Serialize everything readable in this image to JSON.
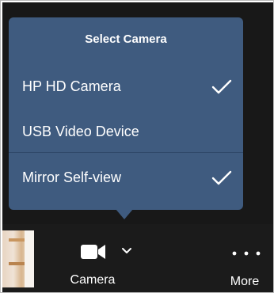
{
  "menu": {
    "title": "Select Camera",
    "items": [
      {
        "label": "HP HD Camera",
        "checked": true
      },
      {
        "label": "USB Video Device",
        "checked": false
      },
      {
        "label": "Mirror Self-view",
        "checked": true
      }
    ]
  },
  "toolbar": {
    "camera_label": "Camera",
    "more_label": "More"
  },
  "icons": {
    "camera": "video-camera-icon",
    "chevron": "chevron-down-icon",
    "more": "more-dots-icon",
    "check": "checkmark-icon"
  },
  "colors": {
    "menu_background": "#3f5b7f",
    "toolbar_background": "#1b1b1b",
    "text": "#ffffff"
  }
}
